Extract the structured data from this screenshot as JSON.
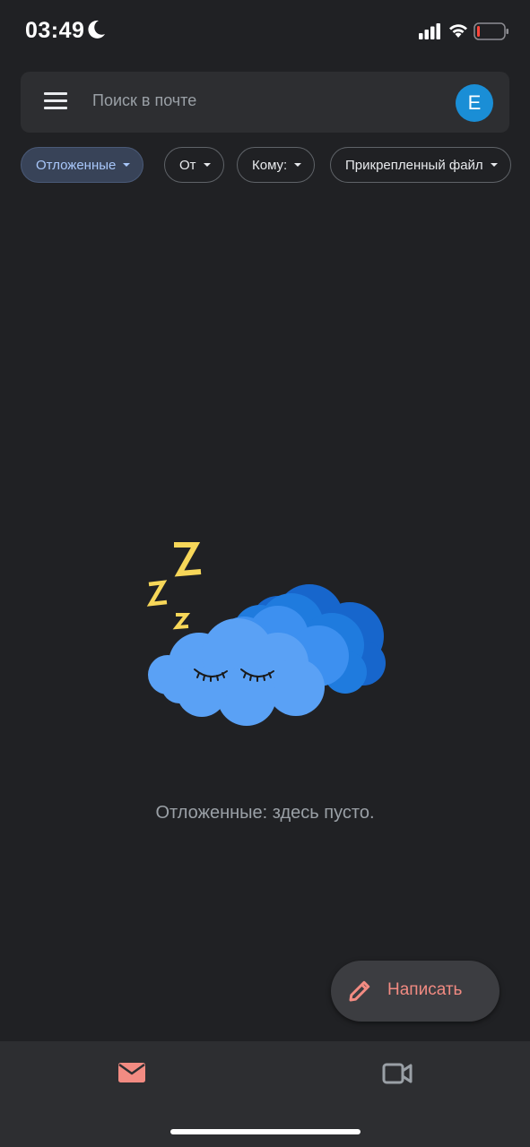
{
  "status_bar": {
    "time": "03:49",
    "icons": [
      "moon-icon",
      "signal-icon",
      "wifi-icon",
      "battery-icon"
    ]
  },
  "search": {
    "placeholder": "Поиск в почте",
    "avatar_letter": "E",
    "avatar_color": "#1a8ed6"
  },
  "filters": [
    {
      "label": "Отложенные",
      "active": true
    },
    {
      "label": "От",
      "active": false
    },
    {
      "label": "Кому:",
      "active": false
    },
    {
      "label": "Прикрепленный файл",
      "active": false
    }
  ],
  "empty_state": {
    "message": "Отложенные: здесь пусто.",
    "illustration": "sleeping-cloud"
  },
  "compose": {
    "label": "Написать",
    "icon": "pencil-icon",
    "accent": "#f28b82"
  },
  "bottom_nav": {
    "items": [
      {
        "name": "mail",
        "icon": "mail-icon",
        "active": true
      },
      {
        "name": "meet",
        "icon": "video-icon",
        "active": false
      }
    ]
  },
  "colors": {
    "background": "#202124",
    "surface": "#2d2e31",
    "active_chip": "#384358",
    "active_chip_text": "#a8c7fa"
  }
}
